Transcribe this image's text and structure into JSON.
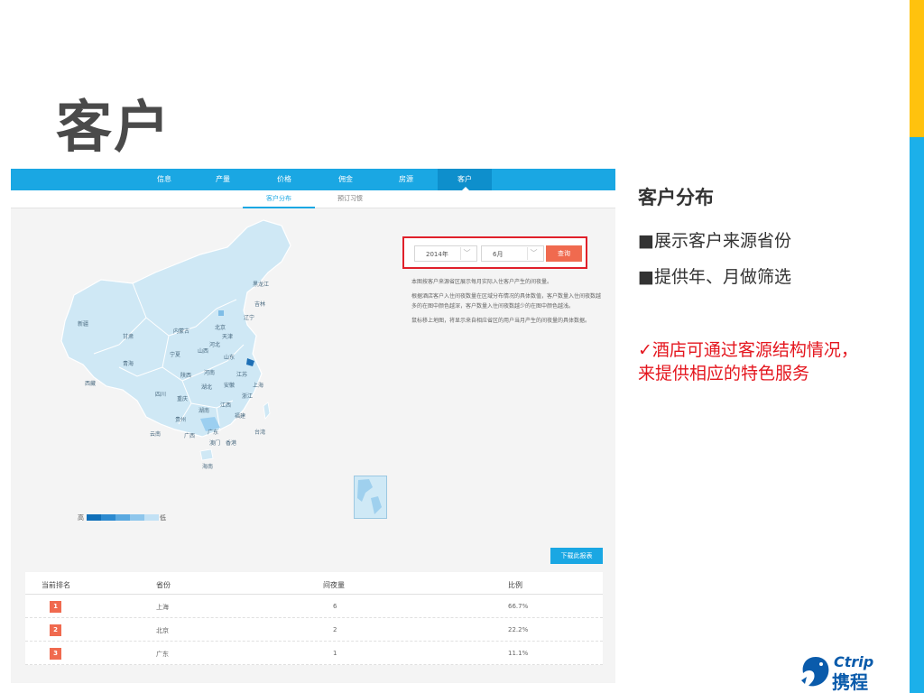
{
  "slide": {
    "title": "客户"
  },
  "right": {
    "title": "客户分布",
    "bullets": [
      "■展示客户来源省份",
      "■提供年、月做筛选"
    ],
    "highlight": "✓酒店可通过客源结构情况，来提供相应的特色服务"
  },
  "app": {
    "nav": [
      "信息",
      "产量",
      "价格",
      "佣金",
      "房源",
      "客户"
    ],
    "nav_active": "客户",
    "subnav": [
      "客户分布",
      "预订习惯"
    ],
    "filter": {
      "year": "2014年",
      "month": "6月",
      "query_label": "查询"
    },
    "description": [
      "本图按客户来源省区展示每月实际入住客户产生的间夜量。",
      "根据酒店客户入住间夜数量在区域分布情况的具体数值，客户数量入住间夜数越多的在图中颜色越深，客户数量入住间夜数越少的在图中颜色越浅。",
      "鼠标移上地图，将显示来自相应省区的用户当月产生的间夜量的具体数据。"
    ],
    "legend": {
      "high": "高",
      "low": "低",
      "colors": [
        "#0f6fb8",
        "#2c8ad0",
        "#5aa9e0",
        "#8ec6ec",
        "#c2e1f5"
      ]
    },
    "map_labels": [
      "黑龙江",
      "吉林",
      "辽宁",
      "新疆",
      "甘肃",
      "内蒙古",
      "北京",
      "天津",
      "宁夏",
      "山西",
      "河北",
      "山东",
      "青海",
      "西藏",
      "陕西",
      "河南",
      "江苏",
      "湖北",
      "安徽",
      "上海",
      "四川",
      "重庆",
      "浙江",
      "江西",
      "湖南",
      "福建",
      "贵州",
      "云南",
      "广西",
      "广东",
      "台湾",
      "澳门",
      "香港",
      "海南"
    ],
    "download_label": "下载此报表",
    "table": {
      "headers": [
        "当前排名",
        "省份",
        "间夜量",
        "比例"
      ],
      "rows": [
        {
          "rank": "1",
          "province": "上海",
          "nights": "6",
          "ratio": "66.7%"
        },
        {
          "rank": "2",
          "province": "北京",
          "nights": "2",
          "ratio": "22.2%"
        },
        {
          "rank": "3",
          "province": "广东",
          "nights": "1",
          "ratio": "11.1%"
        }
      ]
    }
  },
  "logo": {
    "en": "Ctrip",
    "cn": "携程"
  },
  "colors": {
    "yellow": "#ffc20e",
    "blue": "#1cb0ea",
    "accent_red": "#e4161e",
    "nav_blue": "#1aa7e3",
    "rank_orange": "#f06a4f"
  }
}
